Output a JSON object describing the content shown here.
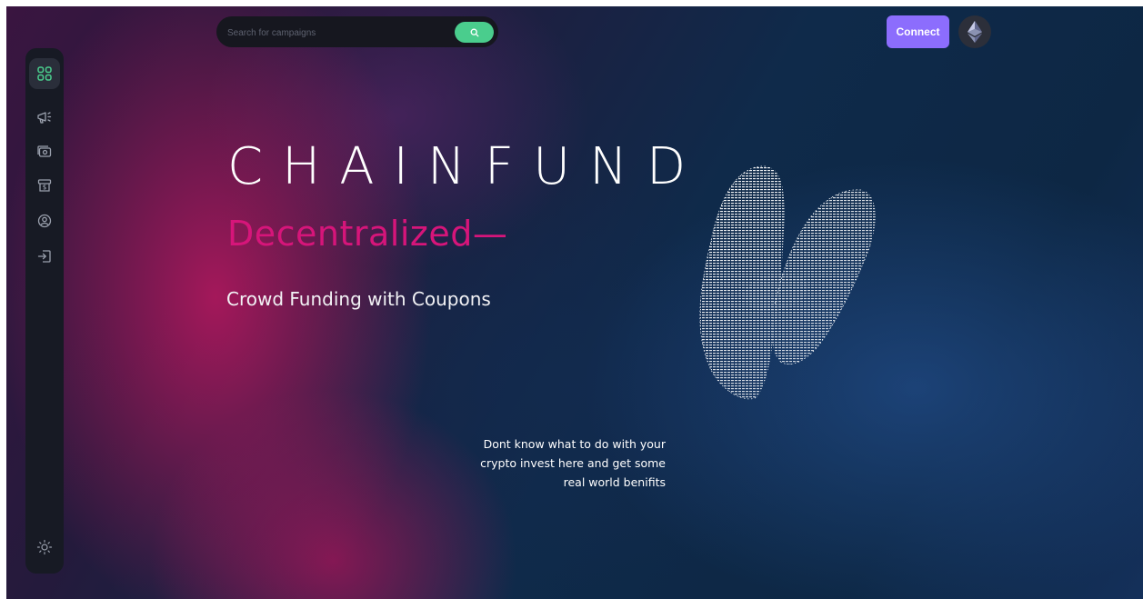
{
  "search": {
    "placeholder": "Search for campaigns"
  },
  "header": {
    "connect_label": "Connect"
  },
  "hero": {
    "title": "CHAINFUND",
    "subtitle": "Decentralized—",
    "tagline": "Crowd Funding with Coupons",
    "blurb_lines": [
      "Dont know what to do with your",
      "crypto invest here and get some",
      "real world benifits"
    ]
  },
  "sidebar": {
    "items": [
      {
        "icon": "dashboard-icon",
        "active": true
      },
      {
        "icon": "campaign-icon",
        "active": false
      },
      {
        "icon": "payment-icon",
        "active": false
      },
      {
        "icon": "withdraw-icon",
        "active": false
      },
      {
        "icon": "profile-icon",
        "active": false
      },
      {
        "icon": "logout-icon",
        "active": false
      }
    ],
    "bottom_icon": "sun-icon"
  },
  "colors": {
    "accent_green": "#4acd8d",
    "connect_purple": "#8c6dfd",
    "subtitle_pink": "#d6157a",
    "sidebar_bg": "#171a24"
  }
}
